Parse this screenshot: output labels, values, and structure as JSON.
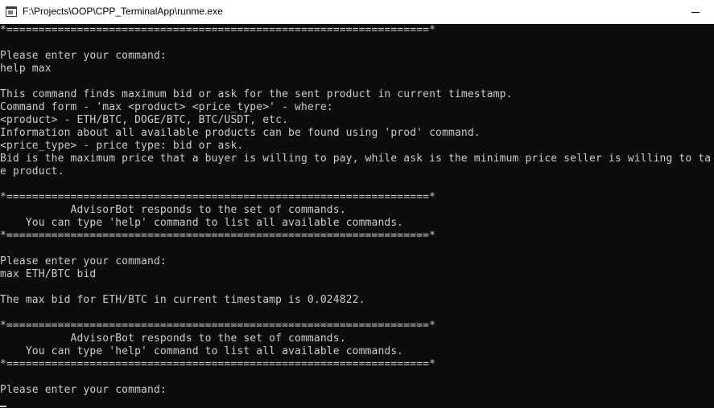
{
  "window": {
    "title": "F:\\Projects\\OOP\\CPP_TerminalApp\\runme.exe",
    "app_icon": "console-app-icon",
    "controls": {
      "minimize_icon": "minimize-icon"
    }
  },
  "console": {
    "background": "#0c0c0c",
    "foreground": "#cccccc",
    "lines": [
      "*==================================================================*",
      "",
      "Please enter your command:",
      "help max",
      "",
      "This command finds maximum bid or ask for the sent product in current timestamp.",
      "Command form - 'max <product> <price_type>' - where:",
      "<product> - ETH/BTC, DOGE/BTC, BTC/USDT, etc.",
      "Information about all available products can be found using 'prod' command.",
      "<price_type> - price type: bid or ask.",
      "Bid is the maximum price that a buyer is willing to pay, while ask is the minimum price seller is willing to ta",
      "e product.",
      "",
      "*==================================================================*",
      "           AdvisorBot responds to the set of commands.",
      "    You can type 'help' command to list all available commands.",
      "*==================================================================*",
      "",
      "Please enter your command:",
      "max ETH/BTC bid",
      "",
      "The max bid for ETH/BTC in current timestamp is 0.024822.",
      "",
      "*==================================================================*",
      "           AdvisorBot responds to the set of commands.",
      "    You can type 'help' command to list all available commands.",
      "*==================================================================*",
      "",
      "Please enter your command:"
    ]
  }
}
